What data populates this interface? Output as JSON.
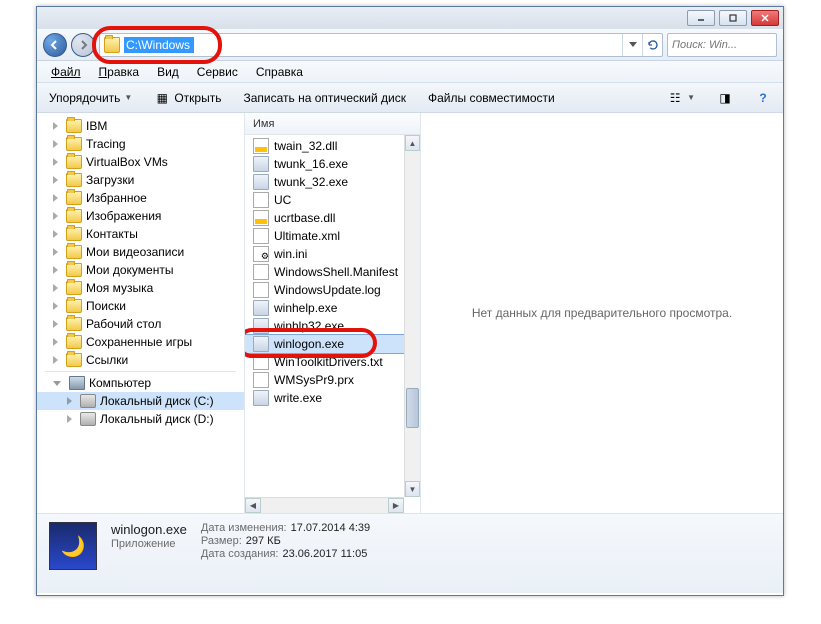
{
  "address": {
    "path": "C:\\Windows"
  },
  "search": {
    "placeholder": "Поиск: Win..."
  },
  "menu": {
    "file": "Файл",
    "edit": "Правка",
    "view": "Вид",
    "tools": "Сервис",
    "help": "Справка"
  },
  "toolbar": {
    "organize": "Упорядочить",
    "open": "Открыть",
    "burn": "Записать на оптический диск",
    "compat": "Файлы совместимости"
  },
  "sidebar": {
    "items": [
      {
        "label": "IBM",
        "icon": "folder",
        "lvl": 1
      },
      {
        "label": "Tracing",
        "icon": "folder",
        "lvl": 1
      },
      {
        "label": "VirtualBox VMs",
        "icon": "folder",
        "lvl": 1
      },
      {
        "label": "Загрузки",
        "icon": "folder",
        "lvl": 1
      },
      {
        "label": "Избранное",
        "icon": "folder",
        "lvl": 1
      },
      {
        "label": "Изображения",
        "icon": "folder",
        "lvl": 1
      },
      {
        "label": "Контакты",
        "icon": "folder",
        "lvl": 1
      },
      {
        "label": "Мои видеозаписи",
        "icon": "folder",
        "lvl": 1
      },
      {
        "label": "Мои документы",
        "icon": "folder",
        "lvl": 1
      },
      {
        "label": "Моя музыка",
        "icon": "folder",
        "lvl": 1
      },
      {
        "label": "Поиски",
        "icon": "folder",
        "lvl": 1
      },
      {
        "label": "Рабочий стол",
        "icon": "folder",
        "lvl": 1
      },
      {
        "label": "Сохраненные игры",
        "icon": "folder",
        "lvl": 1
      },
      {
        "label": "Ссылки",
        "icon": "folder",
        "lvl": 1
      }
    ],
    "computer": "Компьютер",
    "drives": [
      {
        "label": "Локальный диск (C:)",
        "selected": true
      },
      {
        "label": "Локальный диск (D:)",
        "selected": false
      }
    ]
  },
  "filelist": {
    "header": "Имя",
    "files": [
      {
        "name": "twain_32.dll",
        "icon": "dll"
      },
      {
        "name": "twunk_16.exe",
        "icon": "exe"
      },
      {
        "name": "twunk_32.exe",
        "icon": "exe"
      },
      {
        "name": "UC",
        "icon": "txt"
      },
      {
        "name": "ucrtbase.dll",
        "icon": "dll"
      },
      {
        "name": "Ultimate.xml",
        "icon": "xml"
      },
      {
        "name": "win.ini",
        "icon": "ini"
      },
      {
        "name": "WindowsShell.Manifest",
        "icon": "txt"
      },
      {
        "name": "WindowsUpdate.log",
        "icon": "txt"
      },
      {
        "name": "winhelp.exe",
        "icon": "exe"
      },
      {
        "name": "winhlp32.exe",
        "icon": "exe"
      },
      {
        "name": "winlogon.exe",
        "icon": "exe",
        "selected": true,
        "highlight": true
      },
      {
        "name": "WinToolkitDrivers.txt",
        "icon": "txt"
      },
      {
        "name": "WMSysPr9.prx",
        "icon": "txt"
      },
      {
        "name": "write.exe",
        "icon": "exe"
      }
    ]
  },
  "preview": {
    "empty": "Нет данных для предварительного просмотра."
  },
  "details": {
    "name": "winlogon.exe",
    "type": "Приложение",
    "modified_lbl": "Дата изменения:",
    "modified": "17.07.2014 4:39",
    "size_lbl": "Размер:",
    "size": "297 КБ",
    "created_lbl": "Дата создания:",
    "created": "23.06.2017 11:05"
  }
}
